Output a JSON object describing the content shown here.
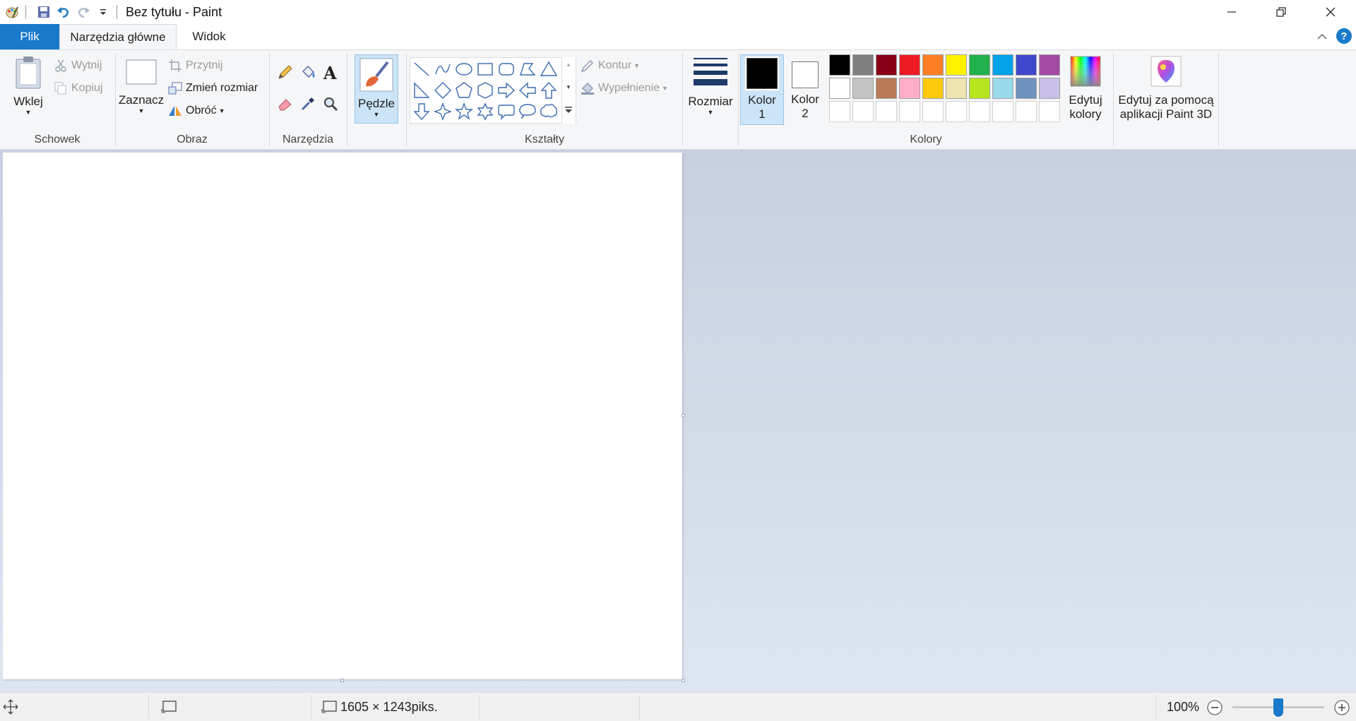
{
  "window": {
    "title": "Bez tytułu - Paint"
  },
  "tabs": {
    "file": "Plik",
    "home": "Narzędzia główne",
    "view": "Widok"
  },
  "clipboard": {
    "label": "Schowek",
    "paste": "Wklej",
    "cut": "Wytnij",
    "copy": "Kopiuj"
  },
  "image": {
    "label": "Obraz",
    "select": "Zaznacz",
    "crop": "Przytnij",
    "resize": "Zmień rozmiar",
    "rotate": "Obróć"
  },
  "tools": {
    "label": "Narzędzia"
  },
  "brushes": {
    "label": "Pędzle"
  },
  "shapes": {
    "label": "Kształty",
    "outline": "Kontur",
    "fill": "Wypełnienie",
    "items": [
      "line",
      "curve",
      "oval",
      "rectangle",
      "rounded-rectangle",
      "polygon",
      "triangle",
      "right-triangle",
      "diamond",
      "pentagon",
      "hexagon",
      "right-arrow",
      "left-arrow",
      "up-arrow",
      "down-arrow",
      "four-point-star",
      "five-point-star",
      "six-point-star",
      "rounded-callout",
      "oval-callout",
      "cloud-callout"
    ]
  },
  "size": {
    "label": "Rozmiar"
  },
  "colors": {
    "label": "Kolory",
    "color1_line1": "Kolor",
    "color1_line2": "1",
    "color2_line1": "Kolor",
    "color2_line2": "2",
    "color1_value": "#000000",
    "color2_value": "#ffffff",
    "edit_line1": "Edytuj",
    "edit_line2": "kolory",
    "palette_row1": [
      "#000000",
      "#7f7f7f",
      "#880015",
      "#ed1c24",
      "#ff7f27",
      "#fff200",
      "#22b14c",
      "#00a2e8",
      "#3f48cc",
      "#a349a4"
    ],
    "palette_row2": [
      "#ffffff",
      "#c3c3c3",
      "#b97a57",
      "#ffaec9",
      "#ffc90e",
      "#efe4b0",
      "#b5e61d",
      "#99d9ea",
      "#7092be",
      "#c8bfe7"
    ]
  },
  "paint3d": {
    "line1": "Edytuj za pomocą",
    "line2": "aplikacji Paint 3D"
  },
  "status": {
    "dimensions": "1605 × 1243piks.",
    "zoom": "100%"
  }
}
